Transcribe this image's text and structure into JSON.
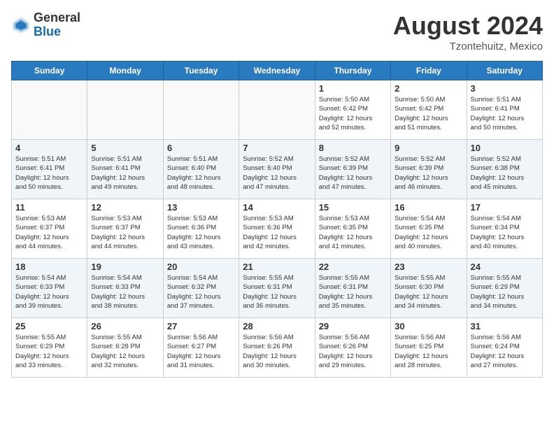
{
  "header": {
    "logo_general": "General",
    "logo_blue": "Blue",
    "title": "August 2024",
    "location": "Tzontehuitz, Mexico"
  },
  "days_of_week": [
    "Sunday",
    "Monday",
    "Tuesday",
    "Wednesday",
    "Thursday",
    "Friday",
    "Saturday"
  ],
  "weeks": [
    [
      {
        "day": "",
        "info": ""
      },
      {
        "day": "",
        "info": ""
      },
      {
        "day": "",
        "info": ""
      },
      {
        "day": "",
        "info": ""
      },
      {
        "day": "1",
        "info": "Sunrise: 5:50 AM\nSunset: 6:42 PM\nDaylight: 12 hours\nand 52 minutes."
      },
      {
        "day": "2",
        "info": "Sunrise: 5:50 AM\nSunset: 6:42 PM\nDaylight: 12 hours\nand 51 minutes."
      },
      {
        "day": "3",
        "info": "Sunrise: 5:51 AM\nSunset: 6:41 PM\nDaylight: 12 hours\nand 50 minutes."
      }
    ],
    [
      {
        "day": "4",
        "info": "Sunrise: 5:51 AM\nSunset: 6:41 PM\nDaylight: 12 hours\nand 50 minutes."
      },
      {
        "day": "5",
        "info": "Sunrise: 5:51 AM\nSunset: 6:41 PM\nDaylight: 12 hours\nand 49 minutes."
      },
      {
        "day": "6",
        "info": "Sunrise: 5:51 AM\nSunset: 6:40 PM\nDaylight: 12 hours\nand 48 minutes."
      },
      {
        "day": "7",
        "info": "Sunrise: 5:52 AM\nSunset: 6:40 PM\nDaylight: 12 hours\nand 47 minutes."
      },
      {
        "day": "8",
        "info": "Sunrise: 5:52 AM\nSunset: 6:39 PM\nDaylight: 12 hours\nand 47 minutes."
      },
      {
        "day": "9",
        "info": "Sunrise: 5:52 AM\nSunset: 6:39 PM\nDaylight: 12 hours\nand 46 minutes."
      },
      {
        "day": "10",
        "info": "Sunrise: 5:52 AM\nSunset: 6:38 PM\nDaylight: 12 hours\nand 45 minutes."
      }
    ],
    [
      {
        "day": "11",
        "info": "Sunrise: 5:53 AM\nSunset: 6:37 PM\nDaylight: 12 hours\nand 44 minutes."
      },
      {
        "day": "12",
        "info": "Sunrise: 5:53 AM\nSunset: 6:37 PM\nDaylight: 12 hours\nand 44 minutes."
      },
      {
        "day": "13",
        "info": "Sunrise: 5:53 AM\nSunset: 6:36 PM\nDaylight: 12 hours\nand 43 minutes."
      },
      {
        "day": "14",
        "info": "Sunrise: 5:53 AM\nSunset: 6:36 PM\nDaylight: 12 hours\nand 42 minutes."
      },
      {
        "day": "15",
        "info": "Sunrise: 5:53 AM\nSunset: 6:35 PM\nDaylight: 12 hours\nand 41 minutes."
      },
      {
        "day": "16",
        "info": "Sunrise: 5:54 AM\nSunset: 6:35 PM\nDaylight: 12 hours\nand 40 minutes."
      },
      {
        "day": "17",
        "info": "Sunrise: 5:54 AM\nSunset: 6:34 PM\nDaylight: 12 hours\nand 40 minutes."
      }
    ],
    [
      {
        "day": "18",
        "info": "Sunrise: 5:54 AM\nSunset: 6:33 PM\nDaylight: 12 hours\nand 39 minutes."
      },
      {
        "day": "19",
        "info": "Sunrise: 5:54 AM\nSunset: 6:33 PM\nDaylight: 12 hours\nand 38 minutes."
      },
      {
        "day": "20",
        "info": "Sunrise: 5:54 AM\nSunset: 6:32 PM\nDaylight: 12 hours\nand 37 minutes."
      },
      {
        "day": "21",
        "info": "Sunrise: 5:55 AM\nSunset: 6:31 PM\nDaylight: 12 hours\nand 36 minutes."
      },
      {
        "day": "22",
        "info": "Sunrise: 5:55 AM\nSunset: 6:31 PM\nDaylight: 12 hours\nand 35 minutes."
      },
      {
        "day": "23",
        "info": "Sunrise: 5:55 AM\nSunset: 6:30 PM\nDaylight: 12 hours\nand 34 minutes."
      },
      {
        "day": "24",
        "info": "Sunrise: 5:55 AM\nSunset: 6:29 PM\nDaylight: 12 hours\nand 34 minutes."
      }
    ],
    [
      {
        "day": "25",
        "info": "Sunrise: 5:55 AM\nSunset: 6:29 PM\nDaylight: 12 hours\nand 33 minutes."
      },
      {
        "day": "26",
        "info": "Sunrise: 5:55 AM\nSunset: 6:28 PM\nDaylight: 12 hours\nand 32 minutes."
      },
      {
        "day": "27",
        "info": "Sunrise: 5:56 AM\nSunset: 6:27 PM\nDaylight: 12 hours\nand 31 minutes."
      },
      {
        "day": "28",
        "info": "Sunrise: 5:56 AM\nSunset: 6:26 PM\nDaylight: 12 hours\nand 30 minutes."
      },
      {
        "day": "29",
        "info": "Sunrise: 5:56 AM\nSunset: 6:26 PM\nDaylight: 12 hours\nand 29 minutes."
      },
      {
        "day": "30",
        "info": "Sunrise: 5:56 AM\nSunset: 6:25 PM\nDaylight: 12 hours\nand 28 minutes."
      },
      {
        "day": "31",
        "info": "Sunrise: 5:56 AM\nSunset: 6:24 PM\nDaylight: 12 hours\nand 27 minutes."
      }
    ]
  ]
}
